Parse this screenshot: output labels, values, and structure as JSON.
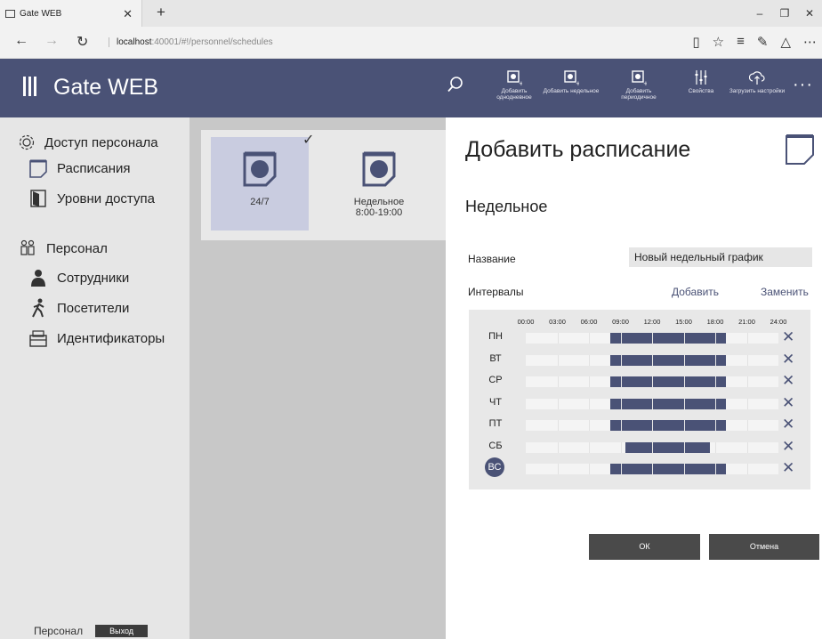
{
  "browser": {
    "tab_title": "Gate WEB",
    "url_host": "localhost",
    "url_path": ":40001/#!/personnel/schedules"
  },
  "header": {
    "title": "Gate WEB",
    "tools": [
      {
        "label": "Добавить однодневное",
        "icon": "calendar-1-add-icon"
      },
      {
        "label": "Добавить недельное",
        "icon": "calendar-7-add-icon"
      },
      {
        "label": "Добавить периодичное",
        "icon": "calendar-periodic-add-icon"
      },
      {
        "label": "Свойства",
        "icon": "sliders-icon"
      },
      {
        "label": "Загрузить настройки",
        "icon": "cloud-upload-icon"
      }
    ]
  },
  "sidebar": {
    "section_access": "Доступ персонала",
    "schedules": "Расписания",
    "access_levels": "Уровни доступа",
    "section_personnel": "Персонал",
    "employees": "Сотрудники",
    "visitors": "Посетители",
    "identifiers": "Идентификаторы",
    "footer_label": "Персонал",
    "exit_label": "Выход"
  },
  "cards": [
    {
      "name": "24/7",
      "sub": "",
      "selected": true
    },
    {
      "name": "Недельное",
      "sub": "8:00-19:00",
      "selected": false
    }
  ],
  "panel": {
    "title": "Добавить расписание",
    "subtitle": "Недельное",
    "name_label": "Название",
    "name_value": "Новый недельный график",
    "intervals_label": "Интервалы",
    "add_label": "Добавить",
    "replace_label": "Заменить",
    "ok_label": "ОК",
    "cancel_label": "Отмена"
  },
  "schedule": {
    "hours": [
      "00:00",
      "03:00",
      "06:00",
      "09:00",
      "12:00",
      "15:00",
      "18:00",
      "21:00",
      "24:00"
    ],
    "days": [
      {
        "label": "ПН",
        "start": 8,
        "end": 19,
        "active": false
      },
      {
        "label": "ВТ",
        "start": 8,
        "end": 19,
        "active": false
      },
      {
        "label": "СР",
        "start": 8,
        "end": 19,
        "active": false
      },
      {
        "label": "ЧТ",
        "start": 8,
        "end": 19,
        "active": false
      },
      {
        "label": "ПТ",
        "start": 8,
        "end": 19,
        "active": false
      },
      {
        "label": "СБ",
        "start": 9.5,
        "end": 17.5,
        "active": false
      },
      {
        "label": "ВС",
        "start": 8,
        "end": 19,
        "active": true
      }
    ]
  },
  "colors": {
    "accent": "#4a5276",
    "sidebar_bg": "#e6e6e6",
    "list_bg": "#c8c8c8"
  }
}
